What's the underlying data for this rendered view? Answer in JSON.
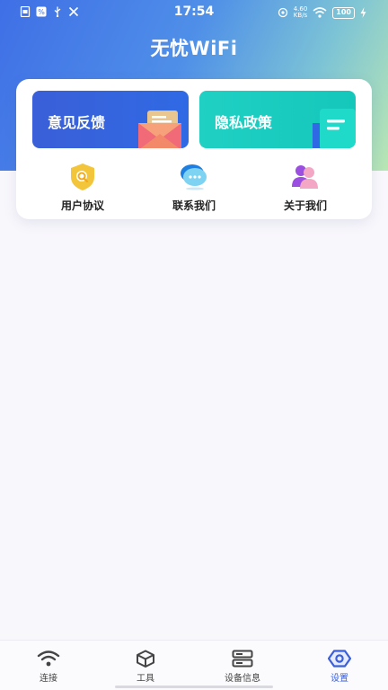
{
  "status_bar": {
    "time": "17:54",
    "net_speed_value": "4.60",
    "net_speed_unit": "KB/s",
    "battery": "100"
  },
  "app": {
    "title": "无忧WiFi"
  },
  "tiles": {
    "feedback": {
      "label": "意见反馈"
    },
    "privacy": {
      "label": "隐私政策"
    }
  },
  "shortcuts": [
    {
      "label": "用户协议",
      "icon": "shield-search-icon"
    },
    {
      "label": "联系我们",
      "icon": "chat-bubbles-icon"
    },
    {
      "label": "关于我们",
      "icon": "people-icon"
    }
  ],
  "bottom_nav": [
    {
      "label": "连接",
      "icon": "wifi-icon",
      "active": false
    },
    {
      "label": "工具",
      "icon": "cube-icon",
      "active": false
    },
    {
      "label": "设备信息",
      "icon": "device-icon",
      "active": false
    },
    {
      "label": "设置",
      "icon": "settings-icon",
      "active": true
    }
  ],
  "colors": {
    "accent": "#3a5fd8",
    "privacy_tile": "#14c7ba",
    "feedback_tile": "#2f6ae4"
  }
}
